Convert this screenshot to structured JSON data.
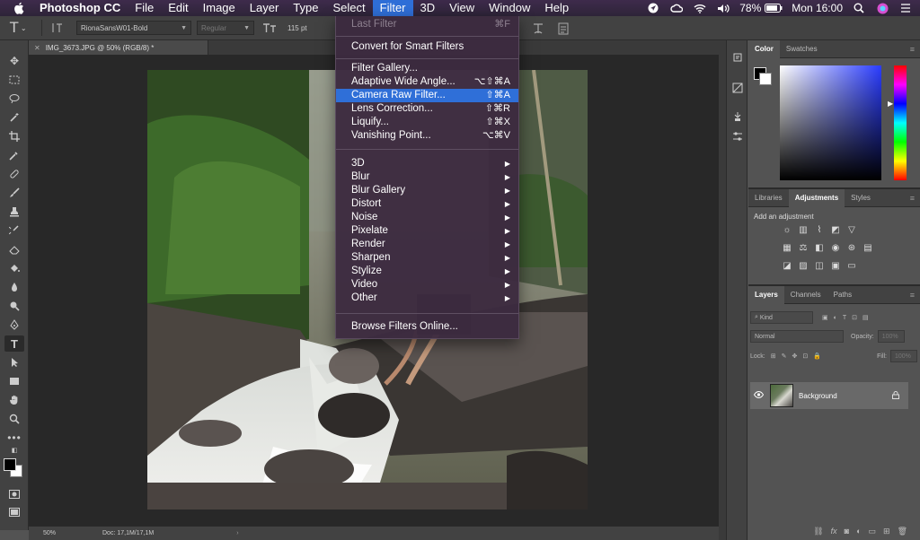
{
  "menubar": {
    "app_name": "Photoshop CC",
    "items": [
      "File",
      "Edit",
      "Image",
      "Layer",
      "Type",
      "Select",
      "Filter",
      "3D",
      "View",
      "Window",
      "Help"
    ],
    "active_index": 6,
    "battery": "78%",
    "clock": "Mon 16:00"
  },
  "options_bar": {
    "font_family": "RionaSansW01-Bold",
    "font_style": "Regular",
    "font_size": "115 pt"
  },
  "document": {
    "tab_title": "IMG_3673.JPG @ 50% (RGB/8) *"
  },
  "status": {
    "zoom": "50%",
    "doc_size": "Doc: 17,1M/17,1M",
    "arrow": "›"
  },
  "filter_menu": {
    "last_filter": {
      "label": "Last Filter",
      "shortcut": "⌘F"
    },
    "convert_smart": {
      "label": "Convert for Smart Filters"
    },
    "group1": [
      {
        "label": "Filter Gallery...",
        "shortcut": ""
      },
      {
        "label": "Adaptive Wide Angle...",
        "shortcut": "⌥⇧⌘A"
      },
      {
        "label": "Camera Raw Filter...",
        "shortcut": "⇧⌘A"
      },
      {
        "label": "Lens Correction...",
        "shortcut": "⇧⌘R"
      },
      {
        "label": "Liquify...",
        "shortcut": "⇧⌘X"
      },
      {
        "label": "Vanishing Point...",
        "shortcut": "⌥⌘V"
      }
    ],
    "highlighted": "Camera Raw Filter...",
    "submenus": [
      "3D",
      "Blur",
      "Blur Gallery",
      "Distort",
      "Noise",
      "Pixelate",
      "Render",
      "Sharpen",
      "Stylize",
      "Video",
      "Other"
    ],
    "browse": {
      "label": "Browse Filters Online..."
    },
    "submenu_arrow": "▶"
  },
  "color_panel": {
    "tabs": [
      "Color",
      "Swatches"
    ],
    "spectrum_hue": "#2a3cff"
  },
  "adjustments_panel": {
    "tabs": [
      "Libraries",
      "Adjustments",
      "Styles"
    ],
    "active_tab": "Adjustments",
    "title": "Add an adjustment"
  },
  "layers_panel": {
    "tabs": [
      "Layers",
      "Channels",
      "Paths"
    ],
    "kind_filter": "Kind",
    "blend_mode": "Normal",
    "opacity_label": "Opacity:",
    "opacity_value": "100%",
    "lock_label": "Lock:",
    "fill_label": "Fill:",
    "fill_value": "100%",
    "layer_name": "Background"
  }
}
